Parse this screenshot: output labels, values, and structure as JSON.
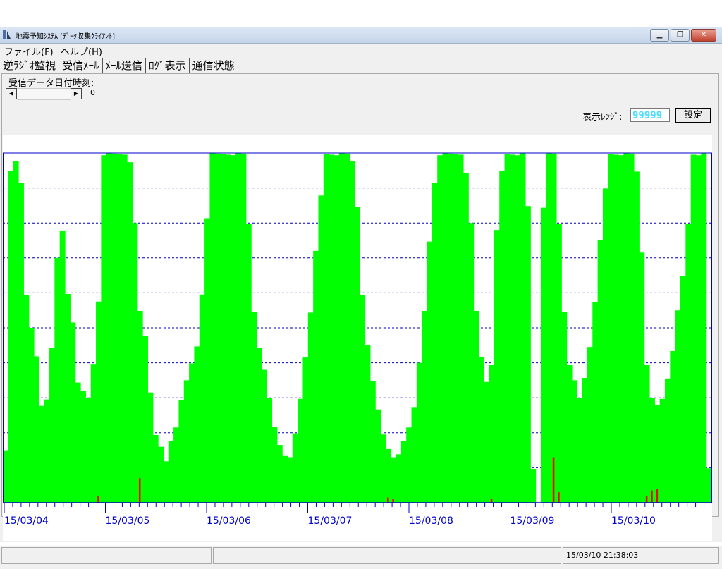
{
  "window": {
    "title": "地震予知ｼｽﾃﾑ [ﾃﾞｰﾀ収集ｸﾗｲｱﾝﾄ]",
    "icon": "app-icon",
    "caption_buttons": [
      "minimize-icon",
      "restore-icon",
      "close-icon"
    ]
  },
  "menu": {
    "file": "ファイル(F)",
    "help": "ヘルプ(H)"
  },
  "tabs": [
    {
      "label": "逆ﾗｼﾞｵ監視",
      "active": true
    },
    {
      "label": "受信ﾒｰﾙ"
    },
    {
      "label": "ﾒｰﾙ送信"
    },
    {
      "label": "ﾛｸﾞ表示"
    },
    {
      "label": "通信状態"
    }
  ],
  "controls": {
    "received_label": "受信データ日付時刻:",
    "scroll_value": "0",
    "range_label": "表示ﾚﾝｼﾞ:",
    "range_value": "99999",
    "set_button": "設定"
  },
  "chart_data": {
    "type": "area",
    "x_labels": [
      "15/03/04",
      "15/03/05",
      "15/03/06",
      "15/03/07",
      "15/03/08",
      "15/03/09",
      "15/03/10"
    ],
    "series": [
      {
        "color": "#00ff00"
      },
      {
        "color": "#ff0000"
      }
    ],
    "grid": true,
    "grid_color": "#0000cc",
    "ylim_fraction": [
      0,
      1
    ],
    "green_levels": [
      0.15,
      0.95,
      0.98,
      0.92,
      0.6,
      0.5,
      0.42,
      0.28,
      0.3,
      0.45,
      0.7,
      0.78,
      0.6,
      0.52,
      0.35,
      0.32,
      0.3,
      0.4,
      0.58,
      1.0,
      1.0,
      1.0,
      1.0,
      1.0,
      0.98,
      0.8,
      0.55,
      0.48,
      0.32,
      0.2,
      0.16,
      0.12,
      0.18,
      0.22,
      0.3,
      0.35,
      0.4,
      0.45,
      0.6,
      0.82,
      1.0,
      1.0,
      1.0,
      1.0,
      1.0,
      1.0,
      1.0,
      0.8,
      0.55,
      0.45,
      0.38,
      0.3,
      0.22,
      0.17,
      0.14,
      0.13,
      0.2,
      0.3,
      0.42,
      0.55,
      0.72,
      0.88,
      1.0,
      1.0,
      1.0,
      1.0,
      1.0,
      0.98,
      0.85,
      0.6,
      0.45,
      0.35,
      0.27,
      0.2,
      0.16,
      0.13,
      0.14,
      0.18,
      0.22,
      0.28,
      0.4,
      0.55,
      0.75,
      0.92,
      1.0,
      1.0,
      1.0,
      1.0,
      1.0,
      0.95,
      0.8,
      0.55,
      0.42,
      0.35,
      0.4,
      0.78,
      0.95,
      1.0,
      1.0,
      1.0,
      1.0,
      0.85,
      0.1,
      0.0,
      0.85,
      1.0,
      1.0,
      0.8,
      0.55,
      0.4,
      0.35,
      0.3,
      0.36,
      0.45,
      0.58,
      0.75,
      0.9,
      1.0,
      1.0,
      1.0,
      1.0,
      1.0,
      0.95,
      0.72,
      0.4,
      0.3,
      0.28,
      0.3,
      0.36,
      0.44,
      0.55,
      0.65,
      0.8,
      1.0,
      1.0,
      1.0,
      0.1
    ],
    "red_levels": [
      0,
      0,
      0,
      0,
      0,
      0,
      0,
      0,
      0,
      0,
      0,
      0,
      0,
      0,
      0,
      0,
      0,
      0,
      0.02,
      0,
      0,
      0,
      0,
      0,
      0,
      0,
      0.07,
      0,
      0,
      0,
      0,
      0,
      0,
      0,
      0,
      0,
      0,
      0,
      0,
      0,
      0,
      0,
      0,
      0,
      0,
      0,
      0,
      0,
      0,
      0,
      0,
      0,
      0,
      0,
      0,
      0,
      0,
      0,
      0,
      0,
      0,
      0,
      0,
      0,
      0,
      0,
      0,
      0,
      0,
      0,
      0,
      0,
      0,
      0,
      0.015,
      0.01,
      0,
      0,
      0,
      0,
      0,
      0,
      0,
      0,
      0,
      0,
      0,
      0,
      0,
      0,
      0,
      0,
      0,
      0,
      0.01,
      0,
      0,
      0,
      0,
      0,
      0,
      0,
      0,
      0,
      0,
      0,
      0.13,
      0.03,
      0,
      0,
      0,
      0,
      0,
      0,
      0,
      0,
      0,
      0,
      0,
      0,
      0,
      0,
      0,
      0,
      0.02,
      0.035,
      0.04,
      0,
      0,
      0,
      0,
      0,
      0,
      0,
      0,
      0,
      0
    ]
  },
  "status": {
    "cells": [
      "",
      "",
      "15/03/10 21:38:03"
    ]
  }
}
